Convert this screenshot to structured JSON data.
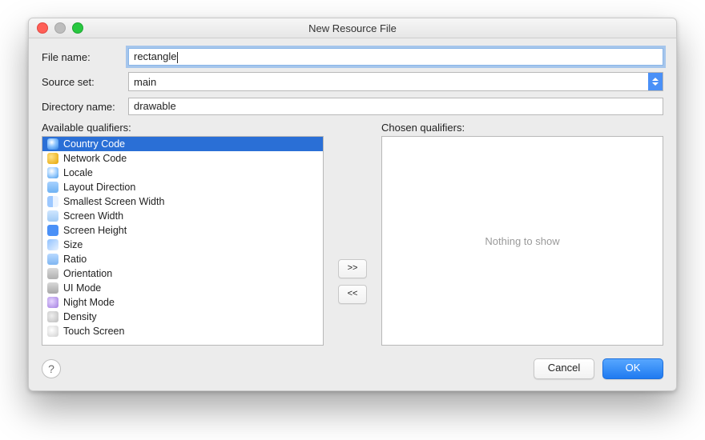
{
  "title": "New Resource File",
  "labels": {
    "file_name": "File name:",
    "source_set": "Source set:",
    "directory": "Directory name:",
    "available": "Available qualifiers:",
    "chosen": "Chosen qualifiers:"
  },
  "values": {
    "file_name": "rectangle",
    "source_set": "main",
    "directory": "drawable",
    "chosen_empty": "Nothing to show"
  },
  "move": {
    "right": ">>",
    "left": "<<"
  },
  "qualifiers": [
    {
      "id": "country-code",
      "label": "Country Code",
      "icon": "ic-globe",
      "selected": true
    },
    {
      "id": "network-code",
      "label": "Network Code",
      "icon": "ic-net"
    },
    {
      "id": "locale",
      "label": "Locale",
      "icon": "ic-locale"
    },
    {
      "id": "layout-direction",
      "label": "Layout Direction",
      "icon": "ic-layout"
    },
    {
      "id": "smallest-screen-width",
      "label": "Smallest Screen Width",
      "icon": "ic-sw"
    },
    {
      "id": "screen-width",
      "label": "Screen Width",
      "icon": "ic-w"
    },
    {
      "id": "screen-height",
      "label": "Screen Height",
      "icon": "ic-h"
    },
    {
      "id": "size",
      "label": "Size",
      "icon": "ic-size"
    },
    {
      "id": "ratio",
      "label": "Ratio",
      "icon": "ic-ratio"
    },
    {
      "id": "orientation",
      "label": "Orientation",
      "icon": "ic-orient"
    },
    {
      "id": "ui-mode",
      "label": "UI Mode",
      "icon": "ic-ui"
    },
    {
      "id": "night-mode",
      "label": "Night Mode",
      "icon": "ic-night"
    },
    {
      "id": "density",
      "label": "Density",
      "icon": "ic-dens"
    },
    {
      "id": "touch-screen",
      "label": "Touch Screen",
      "icon": "ic-touch"
    }
  ],
  "buttons": {
    "cancel": "Cancel",
    "ok": "OK",
    "help": "?"
  }
}
